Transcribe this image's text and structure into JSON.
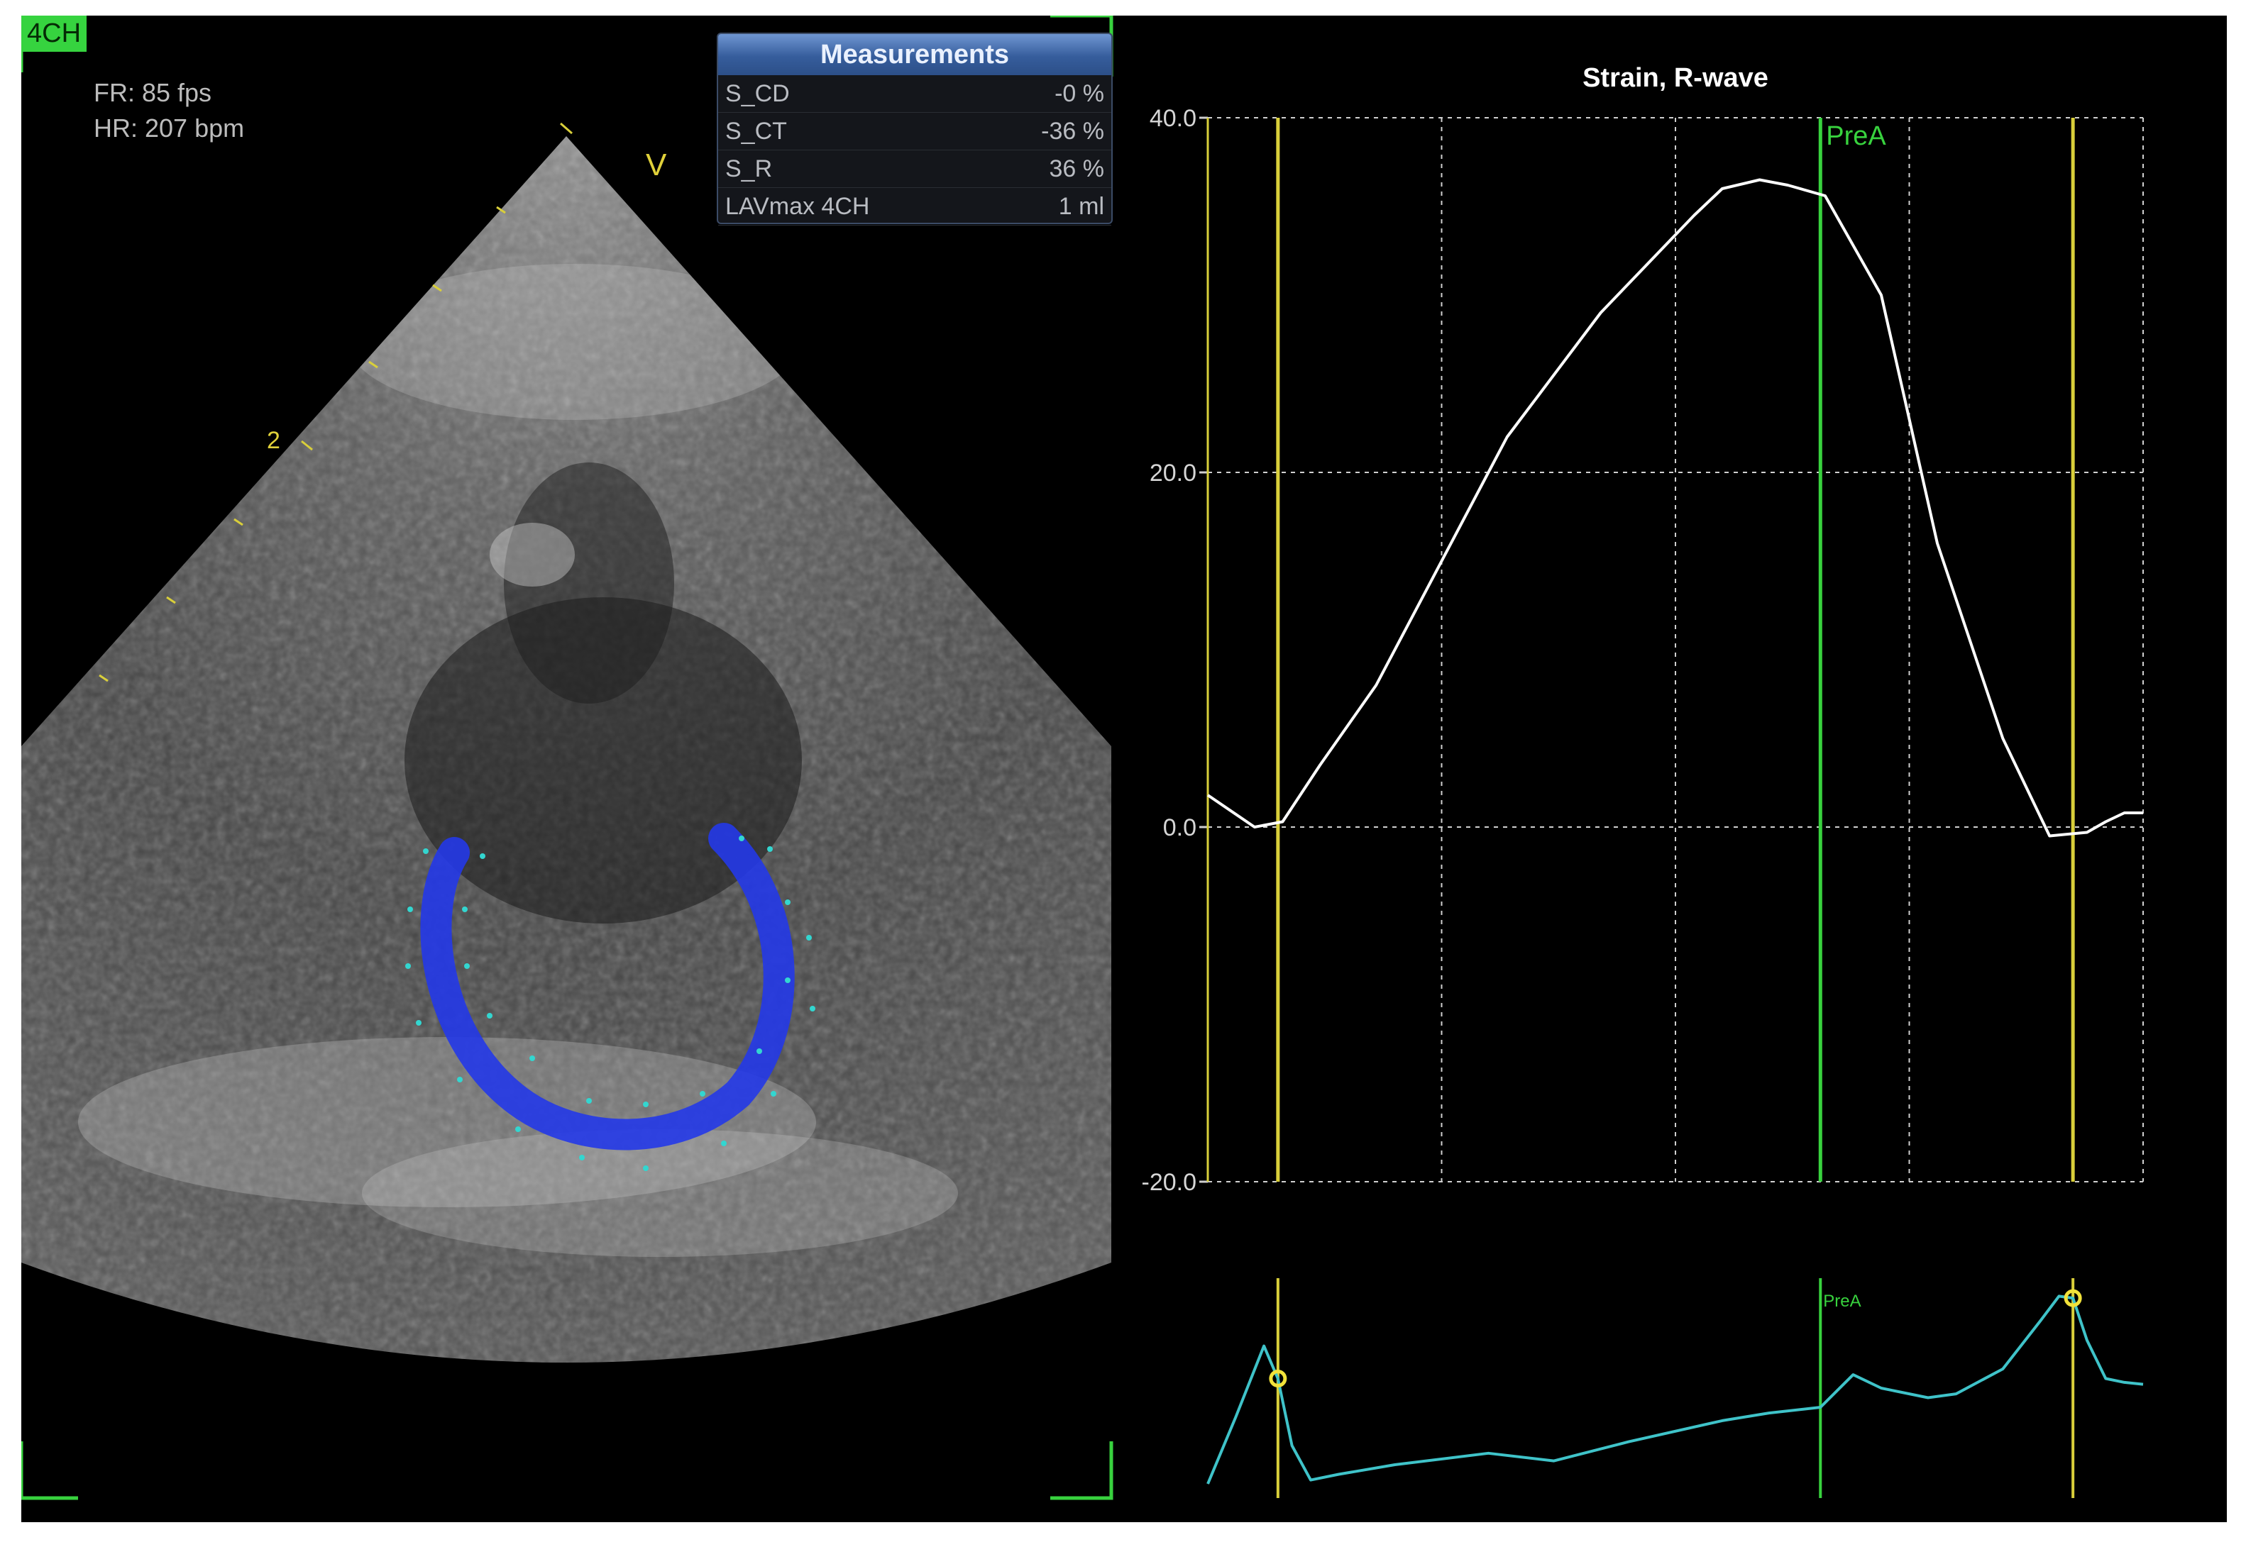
{
  "echo_view": {
    "view_badge": "4CH",
    "frame_rate": "FR: 85 fps",
    "heart_rate": "HR: 207 bpm",
    "marker_v": "V",
    "depth_label": "2"
  },
  "measurements_panel": {
    "title": "Measurements",
    "rows": [
      {
        "label": "S_CD",
        "value": "-0 %"
      },
      {
        "label": "S_CT",
        "value": "-36 %"
      },
      {
        "label": "S_R",
        "value": "36 %"
      },
      {
        "label": "LAVmax 4CH",
        "value": "1 ml"
      }
    ]
  },
  "colors": {
    "background": "#000000",
    "accent_green": "#38d23e",
    "marker_yellow": "#d9cf3a",
    "trace_white": "#ffffff",
    "ecg_cyan": "#3fc3c9",
    "contour_blue": "#2438e8",
    "grid_gray": "#d0d0d0"
  },
  "chart_data": {
    "type": "line",
    "title": "Strain, R-wave",
    "xlabel": "",
    "ylabel": "",
    "ylim": [
      -20,
      40
    ],
    "yticks": [
      "40.0",
      "20.0",
      "0.0",
      "-20.0"
    ],
    "grid": true,
    "x": [
      0.0,
      0.05,
      0.08,
      0.12,
      0.18,
      0.25,
      0.32,
      0.42,
      0.52,
      0.55,
      0.59,
      0.62,
      0.66,
      0.72,
      0.78,
      0.85,
      0.9,
      0.94,
      0.96,
      0.98,
      1.0
    ],
    "series": [
      {
        "values": [
          1.8,
          0.0,
          0.3,
          3.5,
          8.0,
          15.0,
          22.0,
          29.0,
          34.5,
          36.0,
          36.5,
          36.2,
          35.6,
          30.0,
          16.0,
          5.0,
          -0.5,
          -0.3,
          0.3,
          0.8,
          0.8
        ]
      }
    ],
    "markers": [
      {
        "label": "",
        "x": 0.075,
        "color": "#d9cf3a"
      },
      {
        "label": "PreA",
        "x": 0.655,
        "color": "#38d23e"
      },
      {
        "label": "",
        "x": 0.925,
        "color": "#d9cf3a"
      }
    ],
    "ecg": {
      "x": [
        0.0,
        0.03,
        0.06,
        0.075,
        0.09,
        0.11,
        0.14,
        0.2,
        0.3,
        0.37,
        0.45,
        0.55,
        0.6,
        0.655,
        0.69,
        0.72,
        0.77,
        0.8,
        0.85,
        0.89,
        0.91,
        0.925,
        0.94,
        0.96,
        0.98,
        1.0
      ],
      "values": [
        0.0,
        0.35,
        0.72,
        0.55,
        0.2,
        0.02,
        0.05,
        0.1,
        0.16,
        0.12,
        0.22,
        0.33,
        0.37,
        0.4,
        0.57,
        0.5,
        0.45,
        0.47,
        0.6,
        0.85,
        0.98,
        0.97,
        0.75,
        0.55,
        0.53,
        0.52
      ]
    },
    "ecg_markers": [
      {
        "label": "",
        "x": 0.075,
        "color": "#d9cf3a"
      },
      {
        "label": "PreA",
        "x": 0.655,
        "color": "#38d23e"
      },
      {
        "label": "",
        "x": 0.925,
        "color": "#d9cf3a"
      }
    ]
  }
}
